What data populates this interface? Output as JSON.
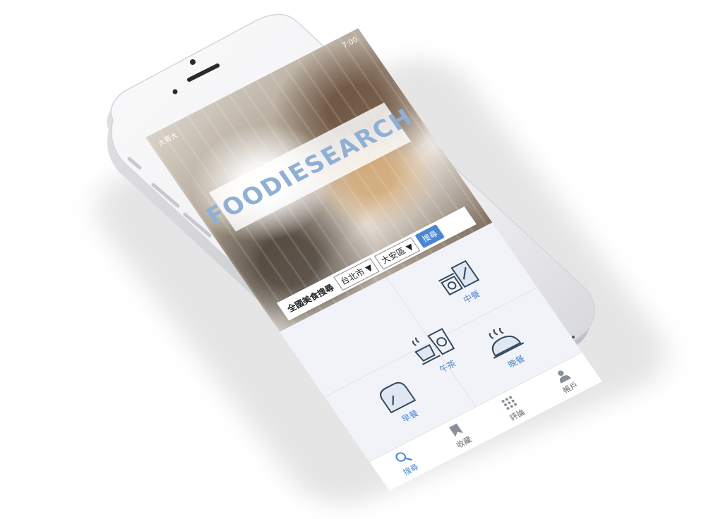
{
  "status": {
    "carrier": "大哥大",
    "time": "7:00"
  },
  "app": {
    "logo": "FOODIESEARCH"
  },
  "search": {
    "label": "全國美食搜尋",
    "city": "台北市 ▼",
    "district": "大安區 ▼",
    "button": "搜尋"
  },
  "categories": [
    {
      "label": "中餐",
      "icon": "lunch-icon"
    },
    {
      "label": "早餐",
      "icon": "breakfast-icon"
    },
    {
      "label": "晚餐",
      "icon": "dinner-icon"
    },
    {
      "label": "午茶",
      "icon": "tea-icon"
    }
  ],
  "tabs": [
    {
      "label": "搜尋",
      "icon": "search-icon"
    },
    {
      "label": "收藏",
      "icon": "bookmark-icon"
    },
    {
      "label": "評論",
      "icon": "review-icon"
    },
    {
      "label": "帳戶",
      "icon": "account-icon"
    }
  ],
  "colors": {
    "accent": "#4a86d4",
    "logo": "#8fb0d4",
    "background": "#f2f3f8"
  }
}
